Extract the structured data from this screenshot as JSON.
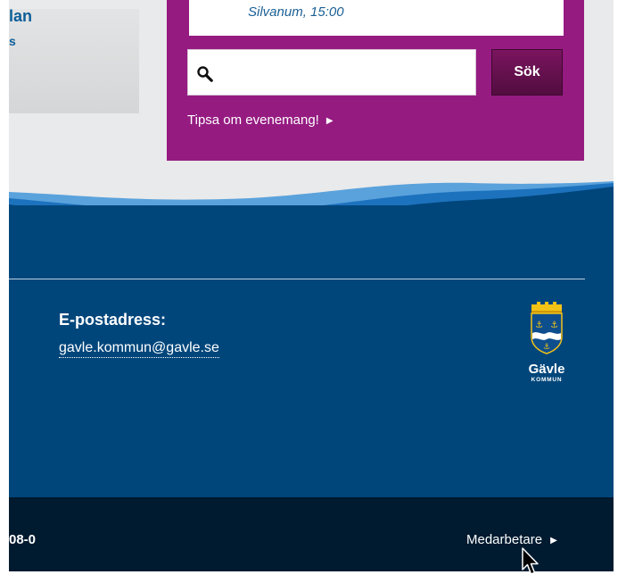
{
  "news_card": {
    "title": "lan",
    "subtitle": "s"
  },
  "event": {
    "listing_text": "Silvanum, 15:00",
    "search": {
      "value": "",
      "button_label": "Sök"
    },
    "tip_link": "Tipsa om evenemang!",
    "panel_color": "#951b81"
  },
  "footer": {
    "email_heading": "E-postadress:",
    "email_link": "gavle.kommun@gavle.se",
    "logo": {
      "name": "Gävle",
      "sub": "KOMMUN"
    },
    "background_color": "#00467b"
  },
  "bottom_bar": {
    "phone_fragment": "08-0",
    "staff_link": "Medarbetare",
    "background_color": "#001a2f"
  },
  "icons": {
    "search": "search-icon",
    "arrow": "play-arrow-icon",
    "cursor": "mouse-pointer-icon"
  }
}
